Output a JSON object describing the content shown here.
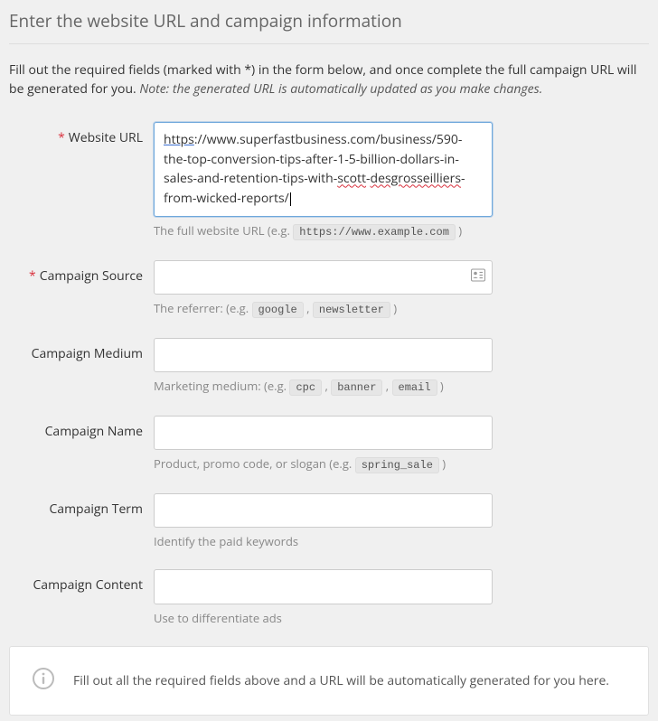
{
  "header": {
    "title": "Enter the website URL and campaign information"
  },
  "intro": {
    "text": "Fill out the required fields (marked with *) in the form below, and once complete the full campaign URL will be generated for you. ",
    "note": "Note: the generated URL is automatically updated as you make changes."
  },
  "fields": {
    "url": {
      "label": "Website URL",
      "required": true,
      "value_prefix": "https",
      "value_rest1": "://www.superfastbusiness.com",
      "value_rest2": "/business/590-the-top-conversion-tips-after-1-5-billion-dollars-in-sales-and-retention-tips-with-",
      "value_spell1": "scott",
      "value_mid": "-",
      "value_spell2": "desgrosseilliers",
      "value_rest3": "-from-wicked-reports/",
      "hint_prefix": "The full website URL (e.g. ",
      "hint_code": "https://www.example.com",
      "hint_suffix": " )"
    },
    "source": {
      "label": "Campaign Source",
      "required": true,
      "value": "",
      "hint_prefix": "The referrer: (e.g. ",
      "hint_code1": "google",
      "hint_sep": " , ",
      "hint_code2": "newsletter",
      "hint_suffix": " )"
    },
    "medium": {
      "label": "Campaign Medium",
      "required": false,
      "value": "",
      "hint_prefix": "Marketing medium: (e.g. ",
      "hint_code1": "cpc",
      "hint_sep": " , ",
      "hint_code2": "banner",
      "hint_code3": "email",
      "hint_suffix": " )"
    },
    "name": {
      "label": "Campaign Name",
      "required": false,
      "value": "",
      "hint_prefix": "Product, promo code, or slogan (e.g. ",
      "hint_code": "spring_sale",
      "hint_suffix": " )"
    },
    "term": {
      "label": "Campaign Term",
      "required": false,
      "value": "",
      "hint": "Identify the paid keywords"
    },
    "content": {
      "label": "Campaign Content",
      "required": false,
      "value": "",
      "hint": "Use to differentiate ads"
    }
  },
  "result": {
    "message": "Fill out all the required fields above and a URL will be automatically generated for you here."
  }
}
